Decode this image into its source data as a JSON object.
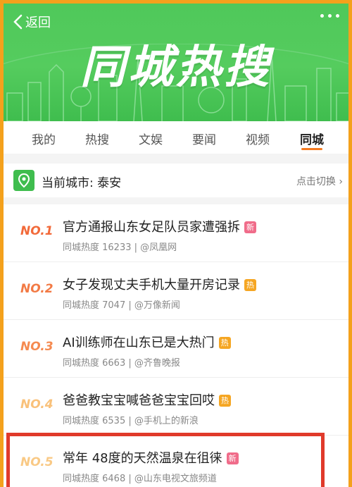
{
  "header": {
    "back_label": "返回",
    "title": "同城热搜"
  },
  "tabs": [
    {
      "label": "我的",
      "active": false
    },
    {
      "label": "热搜",
      "active": false
    },
    {
      "label": "文娱",
      "active": false
    },
    {
      "label": "要闻",
      "active": false
    },
    {
      "label": "视频",
      "active": false
    },
    {
      "label": "同城",
      "active": true
    }
  ],
  "city": {
    "label": "当前城市: 泰安",
    "switch_label": "点击切换 ›"
  },
  "items": [
    {
      "rank": "NO.1",
      "title": "官方通报山东女足队员家遭强拆",
      "badge": "新",
      "badge_type": "new",
      "meta": "同城热度 16233 | @凤凰网"
    },
    {
      "rank": "NO.2",
      "title": "女子发现丈夫手机大量开房记录",
      "badge": "热",
      "badge_type": "hot",
      "meta": "同城热度 7047 | @万像新闻"
    },
    {
      "rank": "NO.3",
      "title": "AI训练师在山东已是大热门",
      "badge": "热",
      "badge_type": "hot",
      "meta": "同城热度 6663 | @齐鲁晚报"
    },
    {
      "rank": "NO.4",
      "title": "爸爸教宝宝喊爸爸宝宝回哎",
      "badge": "热",
      "badge_type": "hot",
      "meta": "同城热度 6535 | @手机上的新浪"
    },
    {
      "rank": "NO.5",
      "title": "常年 48度的天然温泉在徂徕",
      "badge": "新",
      "badge_type": "new",
      "meta": "同城热度 6468 | @山东电视文旅频道"
    }
  ],
  "colors": {
    "banner_green": "#4fc85a",
    "accent_orange": "#f47a20",
    "highlight_red": "#e03a2b",
    "badge_new": "#f06c8a",
    "badge_hot": "#f5a623"
  }
}
